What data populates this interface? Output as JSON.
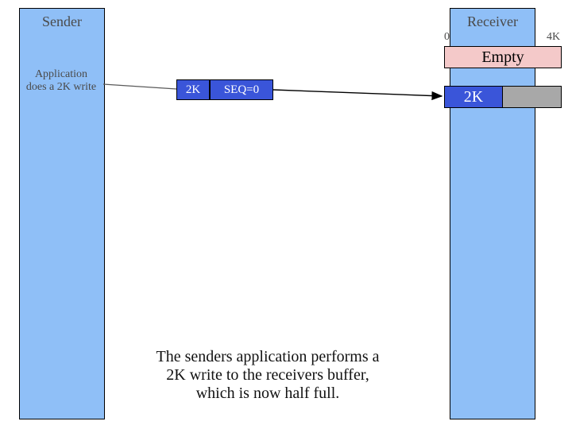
{
  "sender": {
    "title": "Sender"
  },
  "receiver": {
    "title": "Receiver",
    "scale_start": "0",
    "scale_end": "4K"
  },
  "buffers": {
    "empty_label": "Empty",
    "half_label": "2K"
  },
  "app_note": {
    "line1": "Application",
    "line2": "does a 2K write"
  },
  "segment": {
    "size_label": "2K",
    "seq_label": "SEQ=0"
  },
  "caption": {
    "line1": "The senders application performs a",
    "line2": "2K write to the receivers buffer,",
    "line3": "which is now half full."
  }
}
